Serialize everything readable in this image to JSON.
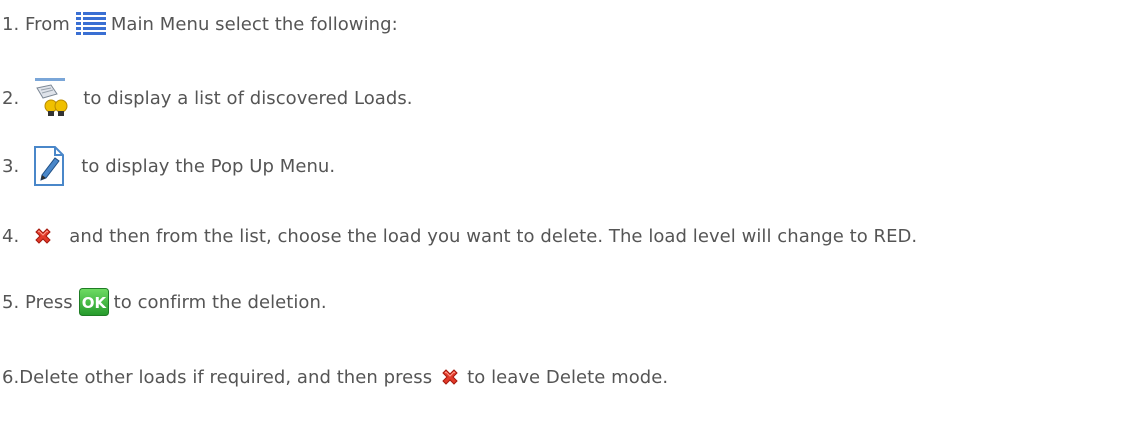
{
  "steps": [
    {
      "before": "1. From",
      "after": "Main Menu select the following:",
      "icon": "main-menu-icon"
    },
    {
      "before": "2.",
      "after": "to display a list of discovered Loads.",
      "icon": "loads-list-icon"
    },
    {
      "before": "3.",
      "after": "to display the Pop Up Menu.",
      "icon": "edit-document-icon"
    },
    {
      "before": "4.",
      "after": "and then from the list, choose the load you want to delete. The load level will change to RED.",
      "icon": "delete-x-icon"
    },
    {
      "before": "5. Press",
      "after": "to confirm the deletion.",
      "icon": "ok-button-icon",
      "icon_text": "OK"
    },
    {
      "before": "6.Delete other loads if required, and then press",
      "after": "to leave Delete mode.",
      "icon": "delete-x-icon"
    }
  ],
  "colors": {
    "text": "#555555",
    "menu_blue": "#3a6fd3",
    "ok_green": "#36b83b",
    "delete_red": "#e23a2a",
    "bulb_yellow": "#f0c000"
  }
}
